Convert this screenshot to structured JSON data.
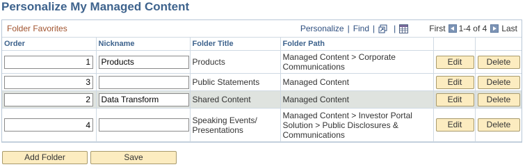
{
  "page": {
    "title": "Personalize My Managed Content"
  },
  "grid": {
    "caption": "Folder Favorites",
    "nav": {
      "personalize": "Personalize",
      "separator": "|",
      "find": "Find",
      "first": "First",
      "range": "1-4 of 4",
      "last": "Last",
      "icons": [
        "view-all-icon",
        "download-icon",
        "prev-arrow-icon",
        "next-arrow-icon"
      ]
    },
    "columns": {
      "order": "Order",
      "nickname": "Nickname",
      "folder_title": "Folder Title",
      "folder_path": "Folder Path"
    },
    "rows": [
      {
        "order": "1",
        "nickname": "Products",
        "folder_title": "Products",
        "folder_path": "Managed Content > Corporate Communications",
        "edit": "Edit",
        "delete": "Delete"
      },
      {
        "order": "3",
        "nickname": "",
        "folder_title": "Public Statements",
        "folder_path": "Managed Content",
        "edit": "Edit",
        "delete": "Delete"
      },
      {
        "order": "2",
        "nickname": "Data Transform",
        "folder_title": "Shared Content",
        "folder_path": "Managed Content",
        "edit": "Edit",
        "delete": "Delete"
      },
      {
        "order": "4",
        "nickname": "",
        "folder_title": "Speaking Events/ Presentations",
        "folder_path": "Managed Content > Investor Portal Solution > Public Disclosures & Communications",
        "edit": "Edit",
        "delete": "Delete"
      }
    ]
  },
  "actions": {
    "add_folder": "Add Folder",
    "save": "Save"
  },
  "colors": {
    "title": "#3e638d",
    "caption": "#a0522d",
    "button_bg": "#fcecc0",
    "highlight_row": "#dfe3df",
    "grid_border": "#b7c6d6"
  }
}
